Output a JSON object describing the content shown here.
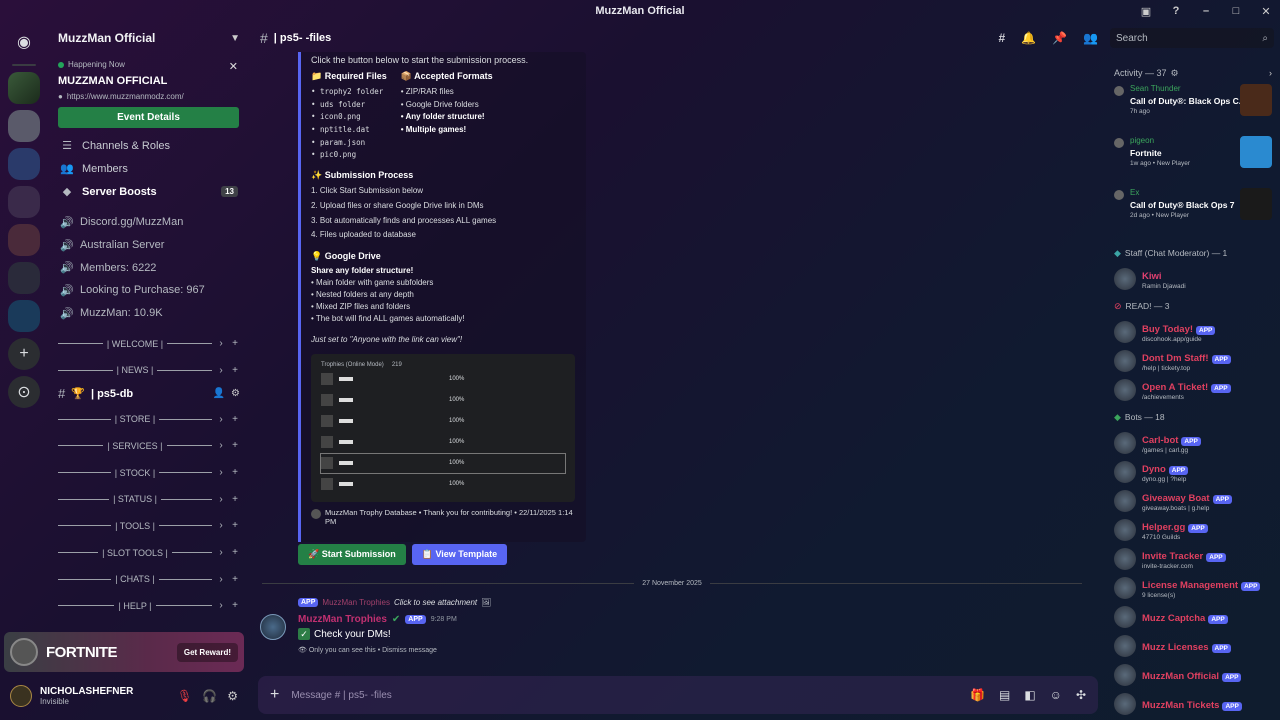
{
  "window": {
    "title": "MuzzMan Official"
  },
  "server": {
    "name": "MuzzMan Official",
    "event": {
      "status": "Happening Now",
      "title": "MUZZMAN OFFICIAL",
      "url": "https://www.muzzmanmodz.com/",
      "button": "Event Details"
    },
    "menu": [
      {
        "label": "Channels & Roles",
        "icon": "list-icon"
      },
      {
        "label": "Members",
        "icon": "members-icon"
      },
      {
        "label": "Server Boosts",
        "icon": "boost-icon",
        "badge": "13"
      }
    ],
    "stats": [
      "Discord.gg/MuzzMan",
      "Australian Server",
      "Members: 6222",
      "Looking to Purchase: 967",
      "MuzzMan: 10.9K"
    ],
    "categories_top": [
      "| WELCOME |",
      "| NEWS |"
    ],
    "active_channel": "| ps5-db",
    "categories_bottom": [
      "| STORE |",
      "| SERVICES |",
      "| STOCK |",
      "| STATUS |",
      "| TOOLS |",
      "| SLOT TOOLS |",
      "| CHATS |",
      "| HELP |"
    ]
  },
  "promo": {
    "word": "FORTNITE",
    "button": "Get Reward!"
  },
  "user": {
    "name": "NICHOLASHEFNER",
    "status": "Invisible"
  },
  "channel": {
    "name": "| ps5- -files",
    "placeholder": "Message # | ps5- -files"
  },
  "search": {
    "placeholder": "Search"
  },
  "embed": {
    "intro": "Click the button below to start the submission process.",
    "required_title": "Required Files",
    "required": [
      "trophy2 folder",
      "uds folder",
      "icon0.png",
      "nptitle.dat",
      "param.json",
      "pic0.png"
    ],
    "formats_title": "Accepted Formats",
    "formats": [
      "ZIP/RAR files",
      "Google Drive folders",
      "Any folder structure!",
      "Multiple games!"
    ],
    "process_title": "Submission Process",
    "process": [
      "1. Click  Start Submission below",
      "2. Upload files or share Google Drive link in DMs",
      "3. Bot automatically finds and processes ALL games",
      "4. Files uploaded to database"
    ],
    "drive_title": "Google Drive",
    "drive": [
      "Share any folder structure!",
      "• Main folder with game subfolders",
      "• Nested folders at any depth",
      "• Mixed ZIP files and folders",
      "• The bot will find ALL games automatically!"
    ],
    "note": "Just set to \"Anyone with the link can view\"!",
    "thumb_header": "Trophies (Online Mode)",
    "thumb_count": "219",
    "thumb_rows": [
      "100%",
      "100%",
      "100%",
      "100%",
      "100%",
      "100%"
    ],
    "footer": "MuzzMan Trophy Database • Thank you for contributing! • 22/11/2025 1:14 PM"
  },
  "buttons": {
    "start": "Start Submission",
    "template": "View Template"
  },
  "divider": "27 November 2025",
  "message": {
    "reply_name": "MuzzMan Trophies",
    "reply_text": "Click to see attachment",
    "author": "MuzzMan Trophies",
    "app": "APP",
    "time": "9:28 PM",
    "text": "Check your DMs!",
    "ephemeral": "Only you can see this • Dismiss message"
  },
  "members": {
    "activity_header": "Activity — 37",
    "activities": [
      {
        "who": "Sean Thunder",
        "game": "Call of Duty®: Black Ops C...",
        "meta": "7h ago",
        "cover": "#4a2a1a"
      },
      {
        "who": "pigeon",
        "game": "Fortnite",
        "meta": "1w ago  •  New Player",
        "cover": "#2a8ad0"
      },
      {
        "who": "Ex",
        "game": "Call of Duty® Black Ops 7",
        "meta": "2d ago  •  New Player",
        "cover": "#1a1a1a"
      }
    ],
    "staff_header": "Staff (Chat Moderator) — 1",
    "staff": [
      {
        "name": "Kiwi",
        "sub": "Ramin Djawadi",
        "color": "#e04070"
      }
    ],
    "ready_header": "READ! — 3",
    "ready": [
      {
        "name": "Buy Today!",
        "sub": "discohook.app/guide",
        "color": "#e04060",
        "app": "APP"
      },
      {
        "name": "Dont Dm Staff!",
        "sub": "/help | tickety.top",
        "color": "#e04060",
        "app": "APP"
      },
      {
        "name": "Open A Ticket!",
        "sub": "/achievements",
        "color": "#e04060",
        "app": "APP"
      }
    ],
    "bots_header": "Bots — 18",
    "bots": [
      {
        "name": "Carl-bot",
        "sub": "/games | carl.gg",
        "color": "#e04060",
        "app": "APP"
      },
      {
        "name": "Dyno",
        "sub": "dyno.gg | ?help",
        "color": "#e04060",
        "app": "APP"
      },
      {
        "name": "Giveaway Boat",
        "sub": "giveaway.boats | g.help",
        "color": "#e04060",
        "app": "APP"
      },
      {
        "name": "Helper.gg",
        "sub": "47710 Guilds",
        "color": "#e04060",
        "app": "APP"
      },
      {
        "name": "Invite Tracker",
        "sub": "invite-tracker.com",
        "color": "#e04060",
        "app": "APP"
      },
      {
        "name": "License Management",
        "sub": "9 license(s)",
        "color": "#e04060",
        "app": "APP"
      },
      {
        "name": "Muzz Captcha",
        "sub": "",
        "color": "#e04060",
        "app": "APP"
      },
      {
        "name": "Muzz Licenses",
        "sub": "",
        "color": "#e04060",
        "app": "APP"
      },
      {
        "name": "MuzzMan Official",
        "sub": "",
        "color": "#e04060",
        "app": "APP"
      },
      {
        "name": "MuzzMan Tickets",
        "sub": "",
        "color": "#e04060",
        "app": "APP"
      }
    ]
  }
}
